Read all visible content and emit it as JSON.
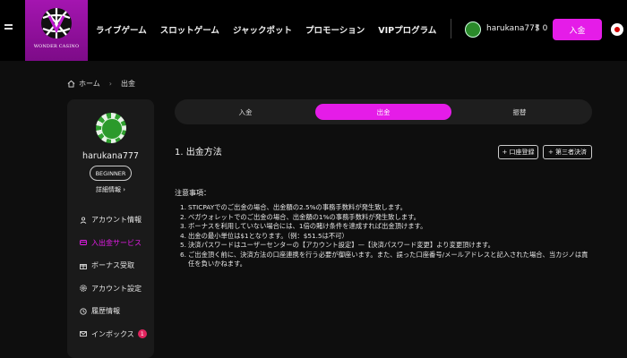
{
  "header": {
    "logo_text": "WONDER CASINO",
    "nav": [
      "ライブゲーム",
      "スロットゲーム",
      "ジャックポット",
      "プロモーション",
      "VIPプログラム"
    ],
    "username": "harukana777",
    "balance": "$ 0",
    "deposit_label": "入金"
  },
  "breadcrumb": {
    "home": "ホーム",
    "current": "出金"
  },
  "sidebar": {
    "username": "harukana777",
    "rank": "BEGINNER",
    "detail_link": "詳細情報",
    "items": [
      {
        "label": "アカウント情報",
        "icon": "user-icon"
      },
      {
        "label": "入出金サービス",
        "icon": "deposit-icon",
        "active": true
      },
      {
        "label": "ボーナス受取",
        "icon": "gift-icon"
      },
      {
        "label": "アカウント設定",
        "icon": "gear-icon"
      },
      {
        "label": "履歴情報",
        "icon": "history-icon"
      },
      {
        "label": "インボックス",
        "icon": "mail-icon",
        "badge": "1"
      }
    ]
  },
  "tabs": [
    "入金",
    "出金",
    "振替"
  ],
  "section": {
    "title": "1. 出金方法",
    "add_account": "+ 口座登録",
    "third_party": "+ 第三者決済"
  },
  "notes": {
    "title": "注意事項：",
    "items": [
      {
        "num": "1.",
        "text": "STICPAYでのご出金の場合、出金額の2.5%の事務手数料が発生致します。"
      },
      {
        "num": "2.",
        "text": "ベガウォレットでのご出金の場合、出金額の1%の事務手数料が発生致します。"
      },
      {
        "num": "3.",
        "text": "ボーナスを利用していない場合には、1倍の賭け条件を達成すれば出金頂けます。"
      },
      {
        "num": "4.",
        "text": "出金の最小単位は$1となります。（例：$51.5は不可）"
      },
      {
        "num": "5.",
        "text": "決済パスワードはユーザーセンターの【アカウント設定】—【決済パスワード変更】より変更頂けます。"
      },
      {
        "num": "6.",
        "text": "ご出金頂く前に、決済方法の口座連携を行う必要が御座います。また、誤った口座番号/メールアドレスと記入された場合、当カジノは責任を負いかねます。"
      }
    ]
  },
  "colors": {
    "accent": "#e51ce8",
    "logo_bg": "#8f12a0",
    "badge": "#e0245e"
  }
}
